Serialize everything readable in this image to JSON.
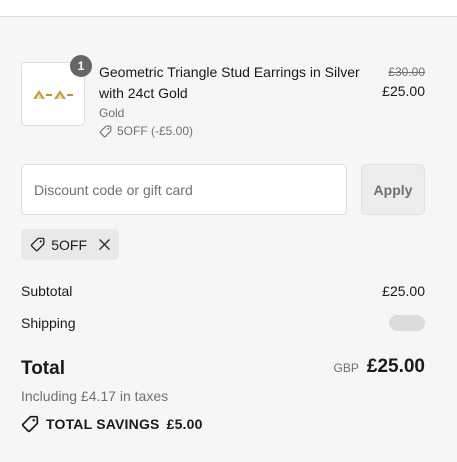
{
  "product": {
    "quantity": "1",
    "title": "Geometric Triangle Stud Earrings in Silver with 24ct Gold",
    "variant": "Gold",
    "discount_label": "5OFF (-£5.00)",
    "original_price": "£30.00",
    "final_price": "£25.00"
  },
  "discount": {
    "placeholder": "Discount code or gift card",
    "apply_label": "Apply",
    "applied_code": "5OFF"
  },
  "summary": {
    "subtotal_label": "Subtotal",
    "subtotal_value": "£25.00",
    "shipping_label": "Shipping",
    "total_label": "Total",
    "currency": "GBP",
    "total_value": "£25.00",
    "taxes_note": "Including £4.17 in taxes",
    "savings_label": "TOTAL SAVINGS",
    "savings_value": "£5.00"
  },
  "colors": {
    "background": "#f6f6f6",
    "text": "#1a1a1a",
    "muted": "#707070",
    "gold": "#c8a24a"
  },
  "icons": {
    "product_image": "triangle-stud-earrings",
    "discount_tag": "tag-icon",
    "remove": "close-icon",
    "savings": "tag-icon"
  }
}
